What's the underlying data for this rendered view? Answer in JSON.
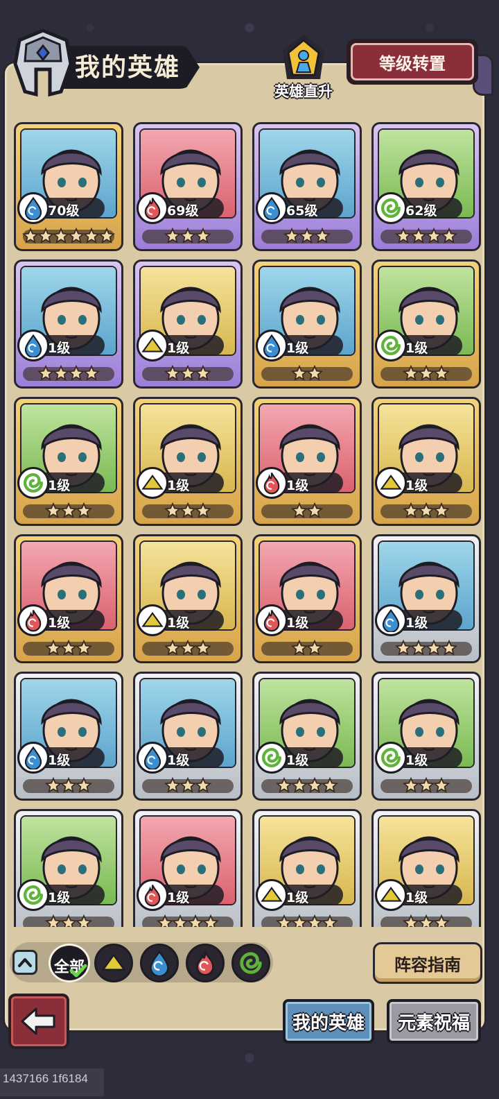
{
  "header": {
    "title": "我的英雄",
    "promote_label": "英雄直升",
    "transfer_button": "等级转置"
  },
  "colors": {
    "water": "#3b8fd0",
    "fire": "#e0575a",
    "earth": "#e2c93a",
    "wind": "#5fb33a",
    "frame_gold": "#d7a44a",
    "frame_purple": "#9c7ed8",
    "frame_silver": "#b8bec6"
  },
  "heroes": [
    {
      "level": "70级",
      "element": "water",
      "frame": "gold",
      "stars": 6
    },
    {
      "level": "69级",
      "element": "fire",
      "frame": "purple",
      "stars": 3
    },
    {
      "level": "65级",
      "element": "water",
      "frame": "purple",
      "stars": 3
    },
    {
      "level": "62级",
      "element": "wind",
      "frame": "purple",
      "stars": 4
    },
    {
      "level": "1级",
      "element": "water",
      "frame": "purple",
      "stars": 4
    },
    {
      "level": "1级",
      "element": "earth",
      "frame": "purple",
      "stars": 3
    },
    {
      "level": "1级",
      "element": "water",
      "frame": "gold",
      "stars": 2
    },
    {
      "level": "1级",
      "element": "wind",
      "frame": "gold",
      "stars": 3
    },
    {
      "level": "1级",
      "element": "wind",
      "frame": "gold",
      "stars": 3
    },
    {
      "level": "1级",
      "element": "earth",
      "frame": "gold",
      "stars": 3
    },
    {
      "level": "1级",
      "element": "fire",
      "frame": "gold",
      "stars": 2
    },
    {
      "level": "1级",
      "element": "earth",
      "frame": "gold",
      "stars": 3
    },
    {
      "level": "1级",
      "element": "fire",
      "frame": "gold",
      "stars": 3
    },
    {
      "level": "1级",
      "element": "earth",
      "frame": "gold",
      "stars": 3
    },
    {
      "level": "1级",
      "element": "fire",
      "frame": "gold",
      "stars": 2
    },
    {
      "level": "1级",
      "element": "water",
      "frame": "silver",
      "stars": 4
    },
    {
      "level": "1级",
      "element": "water",
      "frame": "silver",
      "stars": 3
    },
    {
      "level": "1级",
      "element": "water",
      "frame": "silver",
      "stars": 3
    },
    {
      "level": "1级",
      "element": "wind",
      "frame": "silver",
      "stars": 4
    },
    {
      "level": "1级",
      "element": "wind",
      "frame": "silver",
      "stars": 3
    },
    {
      "level": "1级",
      "element": "wind",
      "frame": "silver",
      "stars": 3
    },
    {
      "level": "1级",
      "element": "fire",
      "frame": "silver",
      "stars": 4
    },
    {
      "level": "1级",
      "element": "earth",
      "frame": "silver",
      "stars": 4
    },
    {
      "level": "1级",
      "element": "earth",
      "frame": "silver",
      "stars": 3
    }
  ],
  "filters": {
    "all_label": "全部",
    "elements": [
      "earth",
      "water",
      "fire",
      "wind"
    ]
  },
  "buttons": {
    "guide": "阵容指南"
  },
  "tabs": {
    "my_heroes": "我的英雄",
    "element_blessing": "元素祝福"
  },
  "footer_caption": "1437166 1f6184"
}
